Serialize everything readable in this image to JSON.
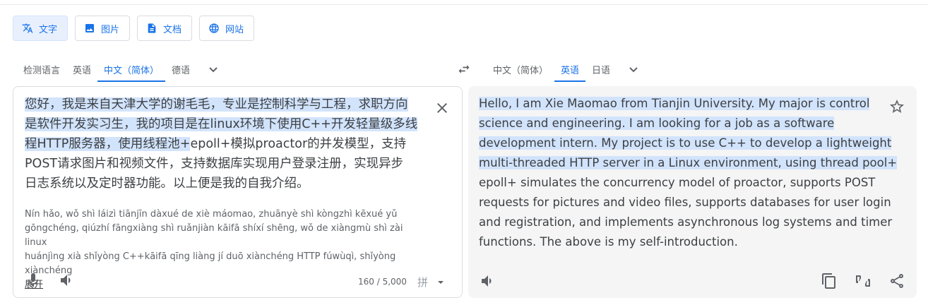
{
  "modes": [
    {
      "label": "文字",
      "icon": "translate-icon"
    },
    {
      "label": "图片",
      "icon": "image-icon"
    },
    {
      "label": "文档",
      "icon": "document-icon"
    },
    {
      "label": "网站",
      "icon": "globe-icon"
    }
  ],
  "source_langs": [
    "检测语言",
    "英语",
    "中文（简体）",
    "德语"
  ],
  "target_langs": [
    "中文（简体）",
    "英语",
    "日语"
  ],
  "source": {
    "lines": [
      {
        "hl": "您好，我是来自天津大学的谢毛毛，专业是控制科学与工程，求职方向",
        "rest": ""
      },
      {
        "hl": "是软件开发实习生，我的项目是在linux环境下使用C++开发轻量级多线",
        "rest": ""
      },
      {
        "hl": "程HTTP服务器，使用线程池+",
        "rest": "epoll+模拟proactor的并发模型，支持"
      },
      {
        "hl": "",
        "rest": "POST请求图片和视频文件，支持数据库实现用户登录注册，实现异步"
      },
      {
        "hl": "",
        "rest": "日志系统以及定时器功能。以上便是我的自我介绍。"
      }
    ],
    "pinyin": [
      "Nín hǎo, wǒ shì láizì tiānjīn dàxué de xiè máomao, zhuānyè shì kòngzhì kēxué yǔ",
      "gōngchéng, qiúzhí fāngxiàng shì ruǎnjiàn kāifā shíxí shēng, wǒ de xiàngmù shì zài linux",
      "huánjìng xià shǐyòng C++kāifā qīng liàng jí duō xiànchéng HTTP fúwùqì, shǐyòng xiànchéng"
    ],
    "expand": "展开",
    "count": "160 / 5,000",
    "ime": "拼"
  },
  "target": {
    "lines": [
      {
        "hl": "Hello, I am Xie Maomao from Tianjin University. My major is control",
        "rest": ""
      },
      {
        "hl": "science and engineering. I am looking for a job as a software",
        "rest": ""
      },
      {
        "hl": "development intern. My project is to use C++ to develop a lightweight",
        "rest": ""
      },
      {
        "hl": "multi-threaded HTTP server in a Linux environment, using thread pool+",
        "rest": ""
      },
      {
        "hl": "",
        "rest": "epoll+ simulates the concurrency model of proactor, supports POST"
      },
      {
        "hl": "",
        "rest": "requests for pictures and video files, supports databases for user login"
      },
      {
        "hl": "",
        "rest": "and registration, and implements asynchronous log systems and timer"
      },
      {
        "hl": "",
        "rest": "functions. The above is my self-introduction."
      }
    ]
  },
  "accent": "#1a73e8"
}
